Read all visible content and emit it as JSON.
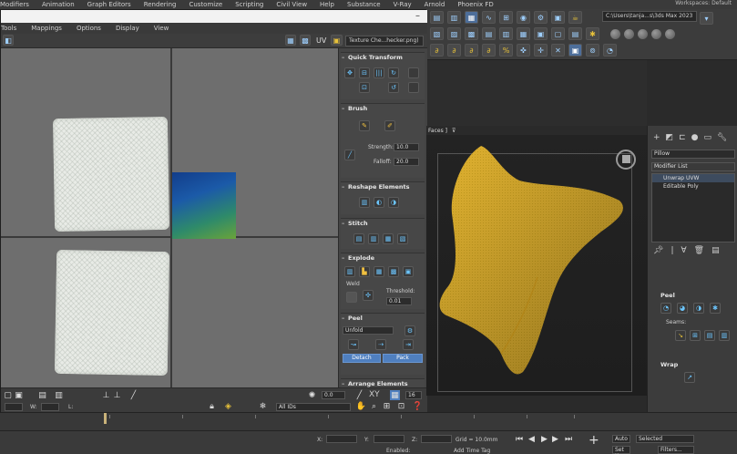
{
  "main_menu": {
    "items": [
      "Modifiers",
      "Animation",
      "Graph Editors",
      "Rendering",
      "Customize",
      "Scripting",
      "Civil View",
      "Help",
      "Substance",
      "V-Ray",
      "Arnold",
      "Phoenix FD"
    ],
    "workspaces_label": "Workspaces:",
    "workspaces_value": "Default"
  },
  "main_toolbar": {
    "project_path": "C:\\Users\\tanja...s\\3ds Max 2023"
  },
  "uv_editor": {
    "menu": [
      "Tools",
      "Mappings",
      "Options",
      "Display",
      "View"
    ],
    "uv_label": "UV",
    "texture_dropdown": "Texture Che...hecker.png)",
    "bottom": {
      "u_value": "0.0",
      "w_label": "W:",
      "l_label": "L:",
      "all_ids": "All IDs",
      "xy_label": "XY",
      "grid_value": "16"
    }
  },
  "quick_peel": {
    "rollouts": {
      "quick_transform": "Quick Transform",
      "brush": "Brush",
      "reshape": "Reshape Elements",
      "stitch": "Stitch",
      "explode": "Explode",
      "peel": "Peel",
      "arrange": "Arrange Elements"
    },
    "strength_label": "Strength:",
    "strength_value": "10.0",
    "falloff_label": "Falloff:",
    "falloff_value": "20.0",
    "weld_label": "Weld",
    "threshold_label": "Threshold:",
    "threshold_value": "0.01",
    "peel_mode": "Unfold",
    "detach_label": "Detach",
    "pack_label": "Pack"
  },
  "viewport": {
    "label": "Faces ]",
    "filter_icon": "filter-icon"
  },
  "command_panel": {
    "object_name": "Pillow",
    "modifier_list": "Modifier List",
    "stack": [
      "Unwrap UVW",
      "Editable Poly"
    ],
    "peel_head": "Peel",
    "seams_label": "Seams:",
    "wrap_head": "Wrap"
  },
  "status": {
    "x_label": "X:",
    "y_label": "Y:",
    "z_label": "Z:",
    "grid": "Grid = 10.0mm",
    "enabled": "Enabled:",
    "add_time_tag": "Add Time Tag",
    "auto": "Auto",
    "selected": "Selected",
    "set_k": "Set K.",
    "filters": "Filters..."
  },
  "colors": {
    "accent": "#4f7fbf",
    "pillow": "#e0b22e",
    "uv_bg": "#6e6e6e"
  }
}
